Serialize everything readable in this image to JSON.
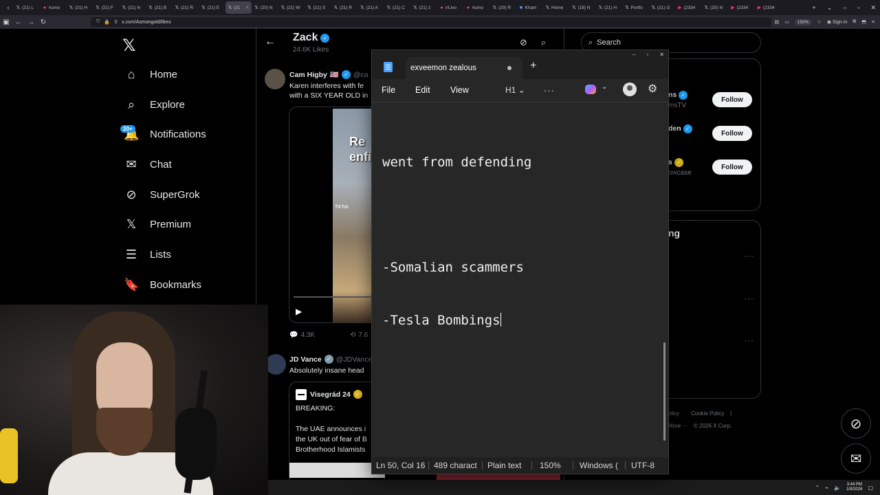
{
  "browser": {
    "tabs": [
      {
        "label": "(21) L",
        "icon": "x-icon",
        "active": false
      },
      {
        "label": "Asmo",
        "icon": "asmon-icon",
        "active": false
      },
      {
        "label": "(21) H",
        "icon": "x-icon",
        "active": false
      },
      {
        "label": "(21) F",
        "icon": "x-icon",
        "active": false
      },
      {
        "label": "(21) N",
        "icon": "x-icon",
        "active": false
      },
      {
        "label": "(21) B",
        "icon": "x-icon",
        "active": false
      },
      {
        "label": "(21) R",
        "icon": "x-icon",
        "active": false
      },
      {
        "label": "(21) E",
        "icon": "x-icon",
        "active": false
      },
      {
        "label": "(21",
        "icon": "x-icon",
        "active": true
      },
      {
        "label": "(20) N",
        "icon": "x-icon",
        "active": false
      },
      {
        "label": "(21) W",
        "icon": "x-icon",
        "active": false
      },
      {
        "label": "(21) S",
        "icon": "x-icon",
        "active": false
      },
      {
        "label": "(21) R",
        "icon": "x-icon",
        "active": false
      },
      {
        "label": "(21) A",
        "icon": "x-icon",
        "active": false
      },
      {
        "label": "(21) C",
        "icon": "x-icon",
        "active": false
      },
      {
        "label": "(21) 2",
        "icon": "x-icon",
        "active": false
      },
      {
        "label": "r/Livo",
        "icon": "reddit-icon",
        "active": false
      },
      {
        "label": "Asmo",
        "icon": "asmon-icon",
        "active": false
      },
      {
        "label": "(20) R",
        "icon": "x-icon",
        "active": false
      },
      {
        "label": "Kham",
        "icon": "shield-icon",
        "active": false
      },
      {
        "label": "Home",
        "icon": "x-icon",
        "active": false
      },
      {
        "label": "(18) N",
        "icon": "x-icon",
        "active": false
      },
      {
        "label": "(21) H",
        "icon": "x-icon",
        "active": false
      },
      {
        "label": "Portfo",
        "icon": "x-icon",
        "active": false
      },
      {
        "label": "(21) G",
        "icon": "x-icon",
        "active": false
      },
      {
        "label": "(2334",
        "icon": "youtube-icon",
        "active": false
      },
      {
        "label": "(20) N",
        "icon": "x-icon",
        "active": false
      },
      {
        "label": "(2334",
        "icon": "youtube-icon",
        "active": false
      },
      {
        "label": "(2334",
        "icon": "youtube-icon",
        "active": false
      }
    ],
    "url": "x.com/Asmongold/likes",
    "zoom": "150%",
    "signin": "Sign in"
  },
  "x_nav": {
    "items": [
      {
        "label": "Home",
        "icon": "home-icon",
        "glyph": "⌂"
      },
      {
        "label": "Explore",
        "icon": "search-icon",
        "glyph": "⌕"
      },
      {
        "label": "Notifications",
        "icon": "bell-icon",
        "glyph": "🔔"
      },
      {
        "label": "Chat",
        "icon": "mail-icon",
        "glyph": "✉"
      },
      {
        "label": "SuperGrok",
        "icon": "grok-icon",
        "glyph": "⊘"
      },
      {
        "label": "Premium",
        "icon": "x-icon",
        "glyph": "𝕏"
      },
      {
        "label": "Lists",
        "icon": "list-icon",
        "glyph": "☰"
      },
      {
        "label": "Bookmarks",
        "icon": "bookmark-icon",
        "glyph": "🔖"
      }
    ],
    "notif_badge": "20+"
  },
  "profile": {
    "name": "Zack",
    "likes": "24.6K Likes"
  },
  "tweet1": {
    "name": "Cam Higby",
    "flag": "🇺🇸",
    "handle": "@ca",
    "text_line1": "Karen interferes with fe",
    "text_line2": "with a SIX YEAR OLD in",
    "video_overlay": "Re\nenfi",
    "tiktok": "TikTok",
    "replies": "4.3K",
    "reposts": "7.6"
  },
  "tweet2": {
    "name": "JD Vance",
    "handle": "@JDVance",
    "text": "Absolutely insane head",
    "quote_name": "Visegrád 24",
    "quote_line1": "BREAKING:",
    "quote_line2": "The UAE announces i",
    "quote_line3": "the UK out of fear of B",
    "quote_line4": "Brotherhood Islamists"
  },
  "right": {
    "search_placeholder": "Search",
    "follow_rows": [
      {
        "name": "ns",
        "sub": "msTV",
        "button": "Follow"
      },
      {
        "name": "den",
        "sub": "",
        "button": "Follow"
      },
      {
        "name": "s",
        "sub": "owcase",
        "button": "Follow"
      }
    ],
    "trending_heading": "ng",
    "footer": [
      "olicy",
      "Cookie Policy",
      "|",
      "More ···",
      "© 2026 X Corp."
    ]
  },
  "notepad": {
    "tab_title": "exveemon zealous",
    "menu": {
      "file": "File",
      "edit": "Edit",
      "view": "View",
      "heading": "H1"
    },
    "content_line1": "went from defending",
    "content_line2": "",
    "content_line3": "-Somalian scammers",
    "content_line4": "-Tesla Bombings",
    "status": {
      "position": "Ln 50, Col 16",
      "chars": "489 charact",
      "format": "Plain text",
      "zoom": "150%",
      "line_ending": "Windows (",
      "encoding": "UTF-8"
    }
  },
  "taskbar": {
    "time": "3:44 PM",
    "date": "1/9/2026"
  }
}
